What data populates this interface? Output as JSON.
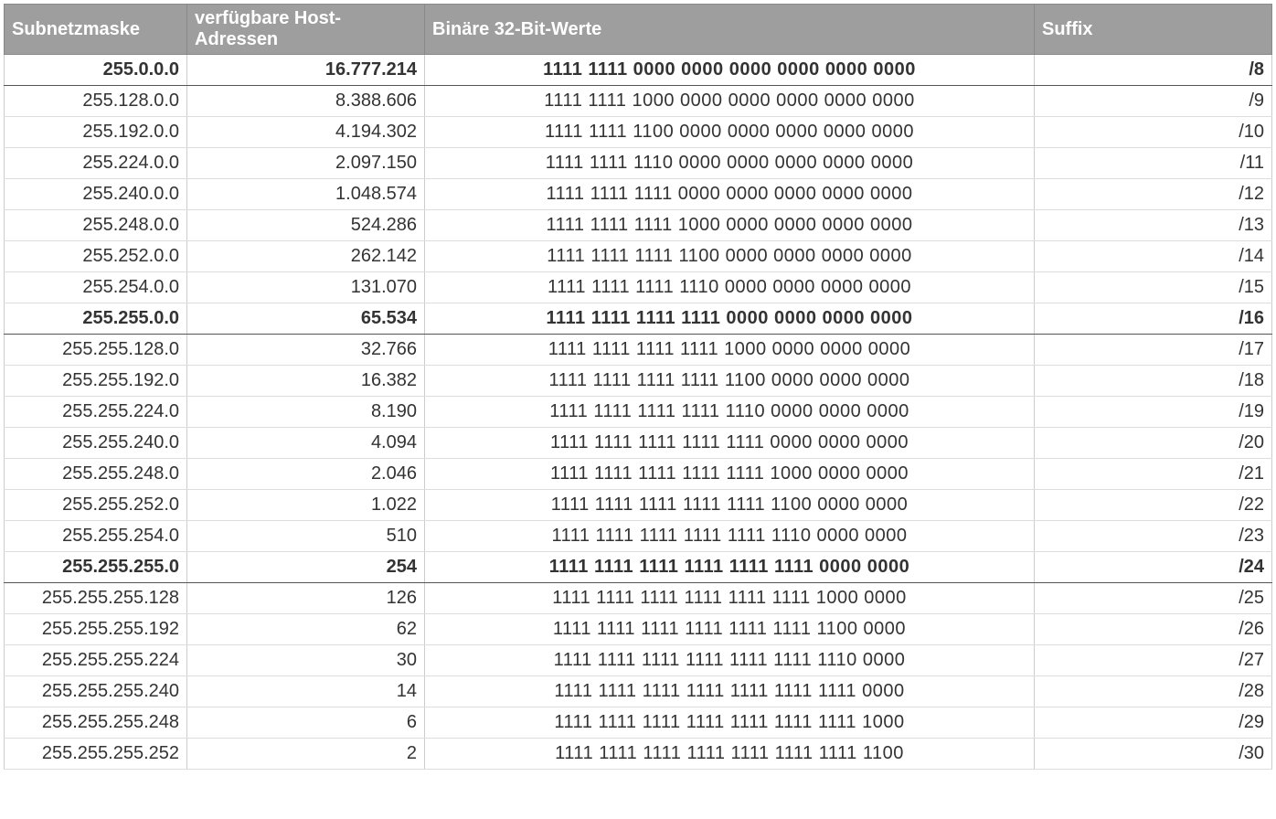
{
  "table": {
    "headers": {
      "subnet": "Subnetzmaske",
      "hosts": "verfügbare Host-Adressen",
      "binary": "Binäre 32-Bit-Werte",
      "suffix": "Suffix"
    },
    "rows": [
      {
        "subnet": "255.0.0.0",
        "hosts": "16.777.214",
        "binary": "1111 1111 0000 0000 0000 0000 0000 0000",
        "suffix": "/8",
        "bold": true
      },
      {
        "subnet": "255.128.0.0",
        "hosts": "8.388.606",
        "binary": "1111 1111 1000 0000 0000 0000 0000 0000",
        "suffix": "/9",
        "bold": false
      },
      {
        "subnet": "255.192.0.0",
        "hosts": "4.194.302",
        "binary": "1111 1111 1100 0000 0000 0000 0000 0000",
        "suffix": "/10",
        "bold": false
      },
      {
        "subnet": "255.224.0.0",
        "hosts": "2.097.150",
        "binary": "1111 1111 1110 0000 0000 0000 0000 0000",
        "suffix": "/11",
        "bold": false
      },
      {
        "subnet": "255.240.0.0",
        "hosts": "1.048.574",
        "binary": "1111 1111 1111 0000 0000 0000 0000 0000",
        "suffix": "/12",
        "bold": false
      },
      {
        "subnet": "255.248.0.0",
        "hosts": "524.286",
        "binary": "1111 1111 1111 1000 0000 0000 0000 0000",
        "suffix": "/13",
        "bold": false
      },
      {
        "subnet": "255.252.0.0",
        "hosts": "262.142",
        "binary": "1111 1111 1111 1100 0000 0000 0000 0000",
        "suffix": "/14",
        "bold": false
      },
      {
        "subnet": "255.254.0.0",
        "hosts": "131.070",
        "binary": "1111 1111 1111 1110 0000 0000 0000 0000",
        "suffix": "/15",
        "bold": false
      },
      {
        "subnet": "255.255.0.0",
        "hosts": "65.534",
        "binary": "1111 1111 1111 1111 0000 0000 0000 0000",
        "suffix": "/16",
        "bold": true
      },
      {
        "subnet": "255.255.128.0",
        "hosts": "32.766",
        "binary": "1111 1111 1111 1111 1000 0000 0000 0000",
        "suffix": "/17",
        "bold": false
      },
      {
        "subnet": "255.255.192.0",
        "hosts": "16.382",
        "binary": "1111 1111 1111 1111 1100 0000 0000 0000",
        "suffix": "/18",
        "bold": false
      },
      {
        "subnet": "255.255.224.0",
        "hosts": "8.190",
        "binary": "1111 1111 1111 1111 1110 0000 0000 0000",
        "suffix": "/19",
        "bold": false
      },
      {
        "subnet": "255.255.240.0",
        "hosts": "4.094",
        "binary": "1111 1111 1111 1111 1111 0000 0000 0000",
        "suffix": "/20",
        "bold": false
      },
      {
        "subnet": "255.255.248.0",
        "hosts": "2.046",
        "binary": "1111 1111 1111 1111 1111 1000 0000 0000",
        "suffix": "/21",
        "bold": false
      },
      {
        "subnet": "255.255.252.0",
        "hosts": "1.022",
        "binary": "1111 1111 1111 1111 1111 1100 0000 0000",
        "suffix": "/22",
        "bold": false
      },
      {
        "subnet": "255.255.254.0",
        "hosts": "510",
        "binary": "1111 1111 1111 1111 1111 1110 0000 0000",
        "suffix": "/23",
        "bold": false
      },
      {
        "subnet": "255.255.255.0",
        "hosts": "254",
        "binary": "1111 1111 1111 1111 1111 1111 0000 0000",
        "suffix": "/24",
        "bold": true
      },
      {
        "subnet": "255.255.255.128",
        "hosts": "126",
        "binary": "1111 1111 1111 1111 1111 1111 1000 0000",
        "suffix": "/25",
        "bold": false
      },
      {
        "subnet": "255.255.255.192",
        "hosts": "62",
        "binary": "1111 1111 1111 1111 1111 1111 1100 0000",
        "suffix": "/26",
        "bold": false
      },
      {
        "subnet": "255.255.255.224",
        "hosts": "30",
        "binary": "1111 1111 1111 1111 1111 1111 1110 0000",
        "suffix": "/27",
        "bold": false
      },
      {
        "subnet": "255.255.255.240",
        "hosts": "14",
        "binary": "1111 1111 1111 1111 1111 1111 1111 0000",
        "suffix": "/28",
        "bold": false
      },
      {
        "subnet": "255.255.255.248",
        "hosts": "6",
        "binary": "1111 1111 1111 1111 1111 1111 1111 1000",
        "suffix": "/29",
        "bold": false
      },
      {
        "subnet": "255.255.255.252",
        "hosts": "2",
        "binary": "1111 1111 1111 1111 1111 1111 1111 1100",
        "suffix": "/30",
        "bold": false
      }
    ]
  }
}
